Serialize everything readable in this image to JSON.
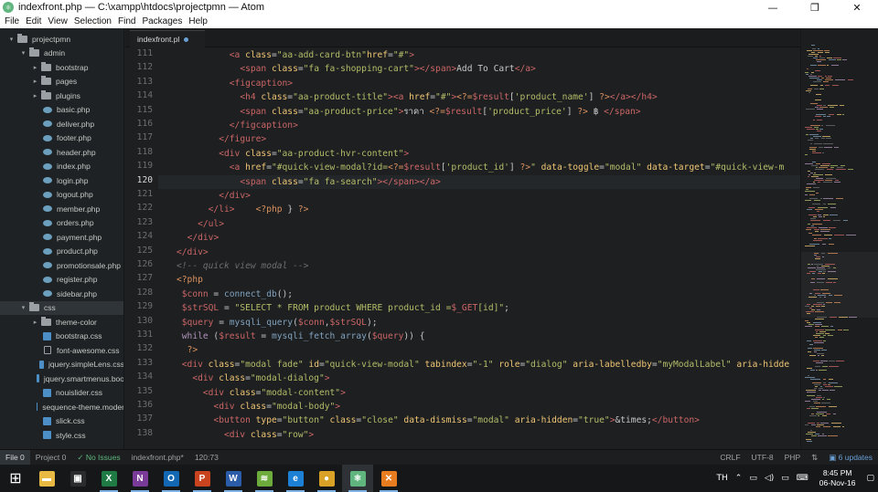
{
  "window": {
    "title": "indexfront.php — C:\\xampp\\htdocs\\projectpmn — Atom",
    "minimize": "—",
    "maximize": "❐",
    "close": "✕"
  },
  "menu": [
    "File",
    "Edit",
    "View",
    "Selection",
    "Find",
    "Packages",
    "Help"
  ],
  "tree": {
    "items": [
      {
        "label": "projectpmn",
        "depth": 0,
        "kind": "folder",
        "open": true
      },
      {
        "label": "admin",
        "depth": 1,
        "kind": "folder",
        "open": true
      },
      {
        "label": "bootstrap",
        "depth": 2,
        "kind": "folder",
        "open": false
      },
      {
        "label": "pages",
        "depth": 2,
        "kind": "folder",
        "open": false
      },
      {
        "label": "plugins",
        "depth": 2,
        "kind": "folder",
        "open": false
      },
      {
        "label": "basic.php",
        "depth": 2,
        "kind": "php"
      },
      {
        "label": "deliver.php",
        "depth": 2,
        "kind": "php"
      },
      {
        "label": "footer.php",
        "depth": 2,
        "kind": "php"
      },
      {
        "label": "header.php",
        "depth": 2,
        "kind": "php"
      },
      {
        "label": "index.php",
        "depth": 2,
        "kind": "php"
      },
      {
        "label": "login.php",
        "depth": 2,
        "kind": "php"
      },
      {
        "label": "logout.php",
        "depth": 2,
        "kind": "php"
      },
      {
        "label": "member.php",
        "depth": 2,
        "kind": "php"
      },
      {
        "label": "orders.php",
        "depth": 2,
        "kind": "php"
      },
      {
        "label": "payment.php",
        "depth": 2,
        "kind": "php"
      },
      {
        "label": "product.php",
        "depth": 2,
        "kind": "php"
      },
      {
        "label": "promotionsale.php",
        "depth": 2,
        "kind": "php"
      },
      {
        "label": "register.php",
        "depth": 2,
        "kind": "php"
      },
      {
        "label": "sidebar.php",
        "depth": 2,
        "kind": "php"
      },
      {
        "label": "css",
        "depth": 1,
        "kind": "folder",
        "open": true,
        "selected": true
      },
      {
        "label": "theme-color",
        "depth": 2,
        "kind": "folder",
        "open": false
      },
      {
        "label": "bootstrap.css",
        "depth": 2,
        "kind": "css"
      },
      {
        "label": "font-awesome.css",
        "depth": 2,
        "kind": "file"
      },
      {
        "label": "jquery.simpleLens.css",
        "depth": 2,
        "kind": "css"
      },
      {
        "label": "jquery.smartmenus.boo",
        "depth": 2,
        "kind": "css"
      },
      {
        "label": "nouislider.css",
        "depth": 2,
        "kind": "css"
      },
      {
        "label": "sequence-theme.moder",
        "depth": 2,
        "kind": "css"
      },
      {
        "label": "slick.css",
        "depth": 2,
        "kind": "css"
      },
      {
        "label": "style.css",
        "depth": 2,
        "kind": "css"
      }
    ]
  },
  "tab": {
    "label": "indexfront.pl"
  },
  "editor": {
    "current_line": 120,
    "lines": [
      {
        "n": "111",
        "segs": [
          [
            "p",
            "          "
          ],
          [
            "t",
            "<a"
          ],
          [
            "a",
            " class"
          ],
          [
            "p",
            "="
          ],
          [
            "s",
            "\"aa-add-card-btn\""
          ],
          [
            "a",
            "href"
          ],
          [
            "p",
            "="
          ],
          [
            "s",
            "\"#\""
          ],
          [
            "t",
            ">"
          ]
        ]
      },
      {
        "n": "112",
        "segs": [
          [
            "p",
            "            "
          ],
          [
            "t",
            "<span"
          ],
          [
            "a",
            " class"
          ],
          [
            "p",
            "="
          ],
          [
            "s",
            "\"fa fa-shopping-cart\""
          ],
          [
            "t",
            "></span>"
          ],
          [
            "p",
            "Add To Cart"
          ],
          [
            "t",
            "</a>"
          ]
        ]
      },
      {
        "n": "113",
        "segs": [
          [
            "p",
            "          "
          ],
          [
            "t",
            "<figcaption>"
          ]
        ]
      },
      {
        "n": "114",
        "segs": [
          [
            "p",
            "            "
          ],
          [
            "t",
            "<h4"
          ],
          [
            "a",
            " class"
          ],
          [
            "p",
            "="
          ],
          [
            "s",
            "\"aa-product-title\""
          ],
          [
            "t",
            "><a"
          ],
          [
            "a",
            " href"
          ],
          [
            "p",
            "="
          ],
          [
            "s",
            "\"#\""
          ],
          [
            "t",
            ">"
          ],
          [
            "ph",
            "<?="
          ],
          [
            "v",
            "$result"
          ],
          [
            "p",
            "["
          ],
          [
            "s",
            "'product_name'"
          ],
          [
            "p",
            "] "
          ],
          [
            "ph",
            "?>"
          ],
          [
            "t",
            "</a></h4>"
          ]
        ]
      },
      {
        "n": "115",
        "segs": [
          [
            "p",
            "            "
          ],
          [
            "t",
            "<span"
          ],
          [
            "a",
            " class"
          ],
          [
            "p",
            "="
          ],
          [
            "s",
            "\"aa-product-price\""
          ],
          [
            "t",
            ">"
          ],
          [
            "p",
            "ราคา "
          ],
          [
            "ph",
            "<?="
          ],
          [
            "v",
            "$result"
          ],
          [
            "p",
            "["
          ],
          [
            "s",
            "'product_price'"
          ],
          [
            "p",
            "] "
          ],
          [
            "ph",
            "?>"
          ],
          [
            "p",
            " ฿ "
          ],
          [
            "t",
            "</span>"
          ]
        ]
      },
      {
        "n": "116",
        "segs": [
          [
            "p",
            "          "
          ],
          [
            "t",
            "</figcaption>"
          ]
        ]
      },
      {
        "n": "117",
        "segs": [
          [
            "p",
            "        "
          ],
          [
            "t",
            "</figure>"
          ]
        ]
      },
      {
        "n": "118",
        "segs": [
          [
            "p",
            "        "
          ],
          [
            "t",
            "<div"
          ],
          [
            "a",
            " class"
          ],
          [
            "p",
            "="
          ],
          [
            "s",
            "\"aa-product-hvr-content\""
          ],
          [
            "t",
            ">"
          ]
        ]
      },
      {
        "n": "119",
        "segs": [
          [
            "p",
            "          "
          ],
          [
            "t",
            "<a"
          ],
          [
            "a",
            " href"
          ],
          [
            "p",
            "="
          ],
          [
            "s",
            "\"#quick-view-modal?id="
          ],
          [
            "ph",
            "<?="
          ],
          [
            "v",
            "$result"
          ],
          [
            "p",
            "["
          ],
          [
            "s",
            "'product_id'"
          ],
          [
            "p",
            "] "
          ],
          [
            "ph",
            "?>"
          ],
          [
            "s",
            "\""
          ],
          [
            "a",
            " data-toggle"
          ],
          [
            "p",
            "="
          ],
          [
            "s",
            "\"modal\""
          ],
          [
            "a",
            " data-target"
          ],
          [
            "p",
            "="
          ],
          [
            "s",
            "\"#quick-view-m"
          ]
        ]
      },
      {
        "n": "120",
        "segs": [
          [
            "p",
            "            "
          ],
          [
            "t",
            "<span"
          ],
          [
            "a",
            " class"
          ],
          [
            "p",
            "="
          ],
          [
            "s",
            "\"fa fa-search\""
          ],
          [
            "t",
            "></span></a>"
          ]
        ]
      },
      {
        "n": "121",
        "segs": [
          [
            "p",
            "        "
          ],
          [
            "t",
            "</div>"
          ]
        ]
      },
      {
        "n": "122",
        "segs": [
          [
            "p",
            "      "
          ],
          [
            "t",
            "</li>"
          ],
          [
            "p",
            "    "
          ],
          [
            "ph",
            "<?php"
          ],
          [
            "p",
            " } "
          ],
          [
            "ph",
            "?>"
          ]
        ]
      },
      {
        "n": "123",
        "segs": [
          [
            "p",
            "    "
          ],
          [
            "t",
            "</ul>"
          ]
        ]
      },
      {
        "n": "124",
        "segs": [
          [
            "p",
            "  "
          ],
          [
            "t",
            "</div>"
          ]
        ]
      },
      {
        "n": "125",
        "segs": [
          [
            "t",
            "</div>"
          ]
        ]
      },
      {
        "n": "126",
        "segs": [
          [
            "c",
            "<!-- quick view modal -->"
          ]
        ]
      },
      {
        "n": "127",
        "segs": [
          [
            "ph",
            "<?php"
          ]
        ]
      },
      {
        "n": "128",
        "segs": [
          [
            "v",
            " $conn"
          ],
          [
            "p",
            " = "
          ],
          [
            "f",
            "connect_db"
          ],
          [
            "p",
            "();"
          ]
        ]
      },
      {
        "n": "129",
        "segs": [
          [
            "v",
            " $strSQL"
          ],
          [
            "p",
            " = "
          ],
          [
            "s",
            "\"SELECT * FROM product WHERE product_id ="
          ],
          [
            "v",
            "$_GET"
          ],
          [
            "s",
            "[id]\""
          ],
          [
            "p",
            ";"
          ]
        ]
      },
      {
        "n": "130",
        "segs": [
          [
            "v",
            " $query"
          ],
          [
            "p",
            " = "
          ],
          [
            "f",
            "mysqli_query"
          ],
          [
            "p",
            "("
          ],
          [
            "v",
            "$conn"
          ],
          [
            "p",
            ","
          ],
          [
            "v",
            "$strSQL"
          ],
          [
            "p",
            ");"
          ]
        ]
      },
      {
        "n": "131",
        "segs": [
          [
            "k",
            " while"
          ],
          [
            "p",
            " ("
          ],
          [
            "v",
            "$result"
          ],
          [
            "p",
            " = "
          ],
          [
            "f",
            "mysqli_fetch_array"
          ],
          [
            "p",
            "("
          ],
          [
            "v",
            "$query"
          ],
          [
            "p",
            ")) {"
          ]
        ]
      },
      {
        "n": "132",
        "segs": [
          [
            "p",
            "  "
          ],
          [
            "ph",
            "?>"
          ]
        ]
      },
      {
        "n": "133",
        "segs": [
          [
            "t",
            " <div"
          ],
          [
            "a",
            " class"
          ],
          [
            "p",
            "="
          ],
          [
            "s",
            "\"modal fade\""
          ],
          [
            "a",
            " id"
          ],
          [
            "p",
            "="
          ],
          [
            "s",
            "\"quick-view-modal\""
          ],
          [
            "a",
            " tabindex"
          ],
          [
            "p",
            "="
          ],
          [
            "s",
            "\"-1\""
          ],
          [
            "a",
            " role"
          ],
          [
            "p",
            "="
          ],
          [
            "s",
            "\"dialog\""
          ],
          [
            "a",
            " aria-labelledby"
          ],
          [
            "p",
            "="
          ],
          [
            "s",
            "\"myModalLabel\""
          ],
          [
            "a",
            " aria-hidde"
          ]
        ]
      },
      {
        "n": "134",
        "segs": [
          [
            "p",
            "   "
          ],
          [
            "t",
            "<div"
          ],
          [
            "a",
            " class"
          ],
          [
            "p",
            "="
          ],
          [
            "s",
            "\"modal-dialog\""
          ],
          [
            "t",
            ">"
          ]
        ]
      },
      {
        "n": "135",
        "segs": [
          [
            "p",
            "     "
          ],
          [
            "t",
            "<div"
          ],
          [
            "a",
            " class"
          ],
          [
            "p",
            "="
          ],
          [
            "s",
            "\"modal-content\""
          ],
          [
            "t",
            ">"
          ]
        ]
      },
      {
        "n": "136",
        "segs": [
          [
            "p",
            "       "
          ],
          [
            "t",
            "<div"
          ],
          [
            "a",
            " class"
          ],
          [
            "p",
            "="
          ],
          [
            "s",
            "\"modal-body\""
          ],
          [
            "t",
            ">"
          ]
        ]
      },
      {
        "n": "137",
        "segs": [
          [
            "p",
            "       "
          ],
          [
            "t",
            "<button"
          ],
          [
            "a",
            " type"
          ],
          [
            "p",
            "="
          ],
          [
            "s",
            "\"button\""
          ],
          [
            "a",
            " class"
          ],
          [
            "p",
            "="
          ],
          [
            "s",
            "\"close\""
          ],
          [
            "a",
            " data-dismiss"
          ],
          [
            "p",
            "="
          ],
          [
            "s",
            "\"modal\""
          ],
          [
            "a",
            " aria-hidden"
          ],
          [
            "p",
            "="
          ],
          [
            "s",
            "\"true\""
          ],
          [
            "t",
            ">"
          ],
          [
            "p",
            "&times;"
          ],
          [
            "t",
            "</button>"
          ]
        ]
      },
      {
        "n": "138",
        "segs": [
          [
            "p",
            "         "
          ],
          [
            "t",
            "<div"
          ],
          [
            "a",
            " class"
          ],
          [
            "p",
            "="
          ],
          [
            "s",
            "\"row\""
          ],
          [
            "t",
            ">"
          ]
        ]
      }
    ]
  },
  "status": {
    "file_tab": "File 0",
    "project_tab": "Project 0",
    "issues": "✓ No Issues",
    "filename": "indexfront.php*",
    "cursor": "120:73",
    "line_ending": "CRLF",
    "encoding": "UTF-8",
    "grammar": "PHP",
    "updates": "6 updates"
  },
  "taskbar": {
    "apps": [
      {
        "name": "start",
        "glyph": "⊞",
        "color": "#161718"
      },
      {
        "name": "file-explorer",
        "glyph": "▬",
        "color": "#e8b943"
      },
      {
        "name": "store",
        "glyph": "▣",
        "color": "#2a2c2e"
      },
      {
        "name": "excel",
        "glyph": "X",
        "color": "#1f7a43"
      },
      {
        "name": "onenote",
        "glyph": "N",
        "color": "#7a3a98"
      },
      {
        "name": "outlook",
        "glyph": "O",
        "color": "#1268b3"
      },
      {
        "name": "powerpoint",
        "glyph": "P",
        "color": "#c9431f"
      },
      {
        "name": "word",
        "glyph": "W",
        "color": "#2a5ca8"
      },
      {
        "name": "layers-app",
        "glyph": "≋",
        "color": "#6cab3c"
      },
      {
        "name": "edge",
        "glyph": "e",
        "color": "#1e80d4"
      },
      {
        "name": "chrome",
        "glyph": "●",
        "color": "#d9a125"
      },
      {
        "name": "atom",
        "glyph": "⚛",
        "color": "#5fb57d"
      },
      {
        "name": "xampp",
        "glyph": "✕",
        "color": "#e87d20"
      }
    ],
    "language": "TH",
    "time": "8:45 PM",
    "date": "06-Nov-16"
  }
}
